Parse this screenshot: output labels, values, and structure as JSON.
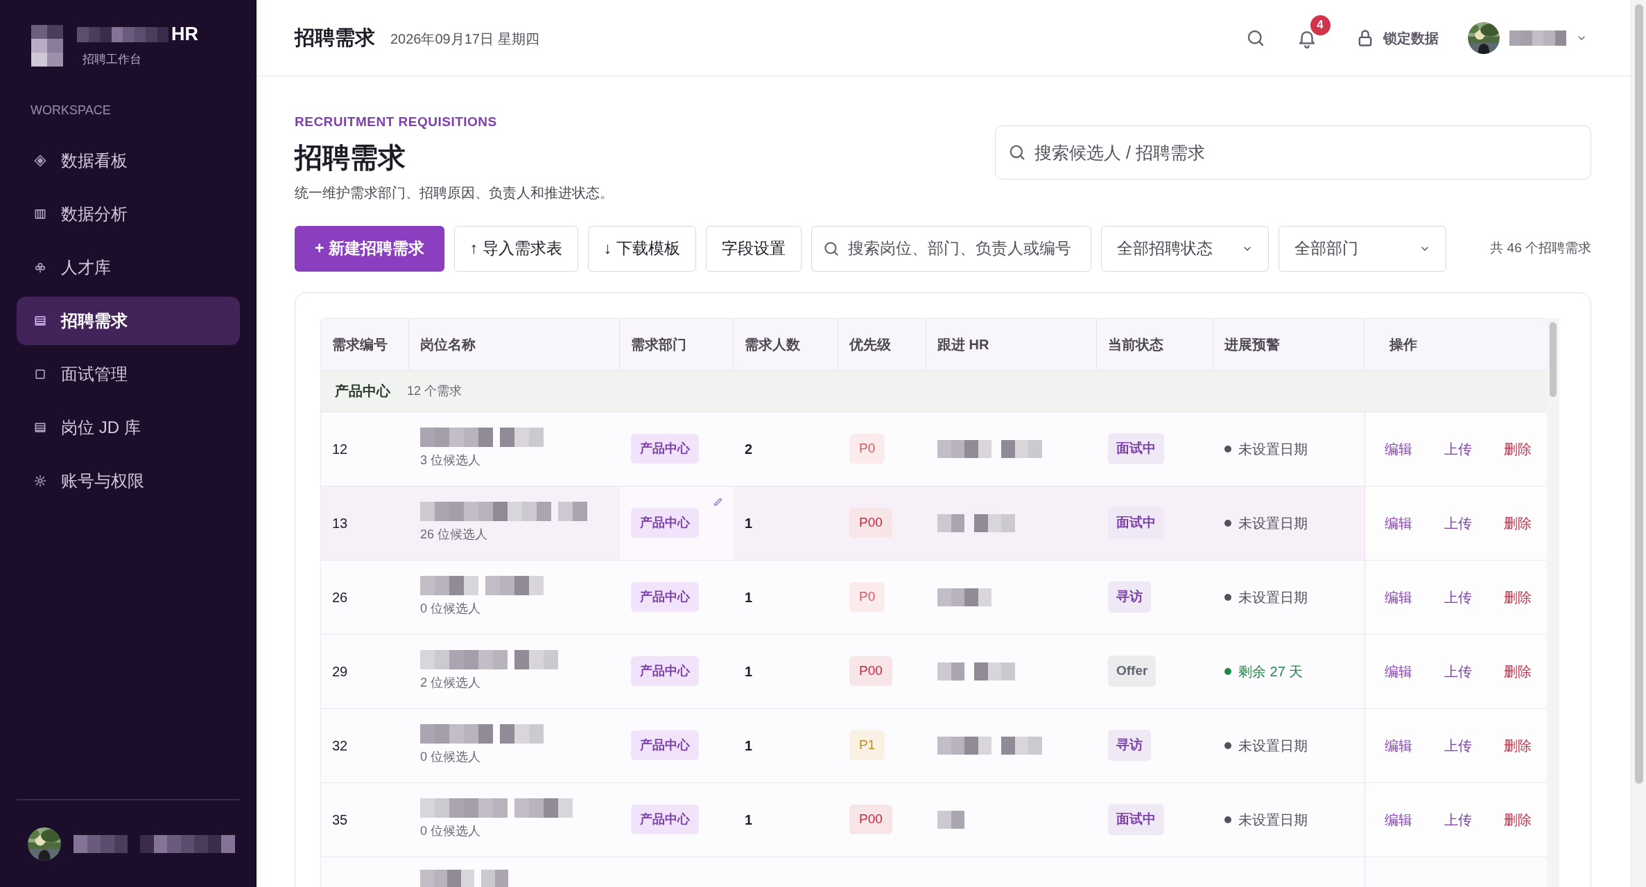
{
  "sidebar": {
    "brand": "HR",
    "subtitle": "招聘工作台",
    "section": "WORKSPACE",
    "items": [
      {
        "label": "数据看板",
        "selected": false
      },
      {
        "label": "数据分析",
        "selected": false
      },
      {
        "label": "人才库",
        "selected": false
      },
      {
        "label": "招聘需求",
        "selected": true
      },
      {
        "label": "面试管理",
        "selected": false
      },
      {
        "label": "岗位 JD 库",
        "selected": false
      },
      {
        "label": "账号与权限",
        "selected": false
      }
    ]
  },
  "header": {
    "title": "招聘需求",
    "date": "2026年09月17日 星期四",
    "notification_count": "4",
    "lock_label": "锁定数据"
  },
  "page": {
    "eyebrow": "RECRUITMENT REQUISITIONS",
    "title": "招聘需求",
    "subtitle": "统一维护需求部门、招聘原因、负责人和推进状态。",
    "global_search": {
      "placeholder": "搜索候选人 / 招聘需求"
    }
  },
  "toolbar": {
    "buttons": [
      {
        "label": "+ 新建招聘需求",
        "kind": "primary"
      },
      {
        "label": "↑ 导入需求表",
        "kind": "default"
      },
      {
        "label": "↓ 下载模板",
        "kind": "default"
      },
      {
        "label": "字段设置",
        "kind": "default"
      }
    ],
    "search": {
      "placeholder": "搜索岗位、部门、负责人或编号"
    },
    "filters": [
      {
        "value": "全部招聘状态"
      },
      {
        "value": "全部部门"
      }
    ],
    "count": "共 46 个招聘需求"
  },
  "table": {
    "columns": [
      "需求编号",
      "岗位名称",
      "需求部门",
      "需求人数",
      "优先级",
      "跟进 HR",
      "当前状态",
      "进展预警",
      "操作"
    ],
    "group": {
      "name": "产品中心",
      "count": "12 个需求"
    },
    "rows": [
      {
        "id": "12",
        "candidates": "3 位候选人",
        "department": "产品中心",
        "headcount": "2",
        "priority": {
          "label": "P0",
          "color": "#e0565d"
        },
        "status": {
          "label": "面试中",
          "color": "#7b3fa8"
        },
        "alert": {
          "label": "未设置日期",
          "color": "#55505c"
        },
        "selected": false,
        "actions": [
          {
            "label": "编辑",
            "kind": "edit"
          },
          {
            "label": "上传",
            "kind": "upload"
          },
          {
            "label": "删除",
            "kind": "delete"
          }
        ]
      },
      {
        "id": "13",
        "candidates": "26 位候选人",
        "department": "产品中心",
        "headcount": "1",
        "priority": {
          "label": "P00",
          "color": "#c12a42"
        },
        "status": {
          "label": "面试中",
          "color": "#7b3fa8"
        },
        "alert": {
          "label": "未设置日期",
          "color": "#55505c"
        },
        "selected": true,
        "actions": [
          {
            "label": "编辑",
            "kind": "edit"
          },
          {
            "label": "上传",
            "kind": "upload"
          },
          {
            "label": "删除",
            "kind": "delete"
          }
        ]
      },
      {
        "id": "26",
        "candidates": "0 位候选人",
        "department": "产品中心",
        "headcount": "1",
        "priority": {
          "label": "P0",
          "color": "#e0565d"
        },
        "status": {
          "label": "寻访",
          "color": "#7b3fa8"
        },
        "alert": {
          "label": "未设置日期",
          "color": "#55505c"
        },
        "selected": false,
        "actions": [
          {
            "label": "编辑",
            "kind": "edit"
          },
          {
            "label": "上传",
            "kind": "upload"
          },
          {
            "label": "删除",
            "kind": "delete"
          }
        ]
      },
      {
        "id": "29",
        "candidates": "2 位候选人",
        "department": "产品中心",
        "headcount": "1",
        "priority": {
          "label": "P00",
          "color": "#c12a42"
        },
        "status": {
          "label": "Offer",
          "color": "#5e6470"
        },
        "alert": {
          "label": "剩余 27 天",
          "color": "#21874a"
        },
        "selected": false,
        "actions": [
          {
            "label": "编辑",
            "kind": "edit"
          },
          {
            "label": "上传",
            "kind": "upload"
          },
          {
            "label": "删除",
            "kind": "delete"
          }
        ]
      },
      {
        "id": "32",
        "candidates": "0 位候选人",
        "department": "产品中心",
        "headcount": "1",
        "priority": {
          "label": "P1",
          "color": "#c4891c"
        },
        "status": {
          "label": "寻访",
          "color": "#7b3fa8"
        },
        "alert": {
          "label": "未设置日期",
          "color": "#55505c"
        },
        "selected": false,
        "actions": [
          {
            "label": "编辑",
            "kind": "edit"
          },
          {
            "label": "上传",
            "kind": "upload"
          },
          {
            "label": "删除",
            "kind": "delete"
          }
        ]
      },
      {
        "id": "35",
        "candidates": "0 位候选人",
        "department": "产品中心",
        "headcount": "1",
        "priority": {
          "label": "P00",
          "color": "#c12a42"
        },
        "status": {
          "label": "面试中",
          "color": "#7b3fa8"
        },
        "alert": {
          "label": "未设置日期",
          "color": "#55505c"
        },
        "selected": false,
        "actions": [
          {
            "label": "编辑",
            "kind": "edit"
          },
          {
            "label": "上传",
            "kind": "upload"
          },
          {
            "label": "删除",
            "kind": "delete"
          }
        ]
      }
    ]
  }
}
